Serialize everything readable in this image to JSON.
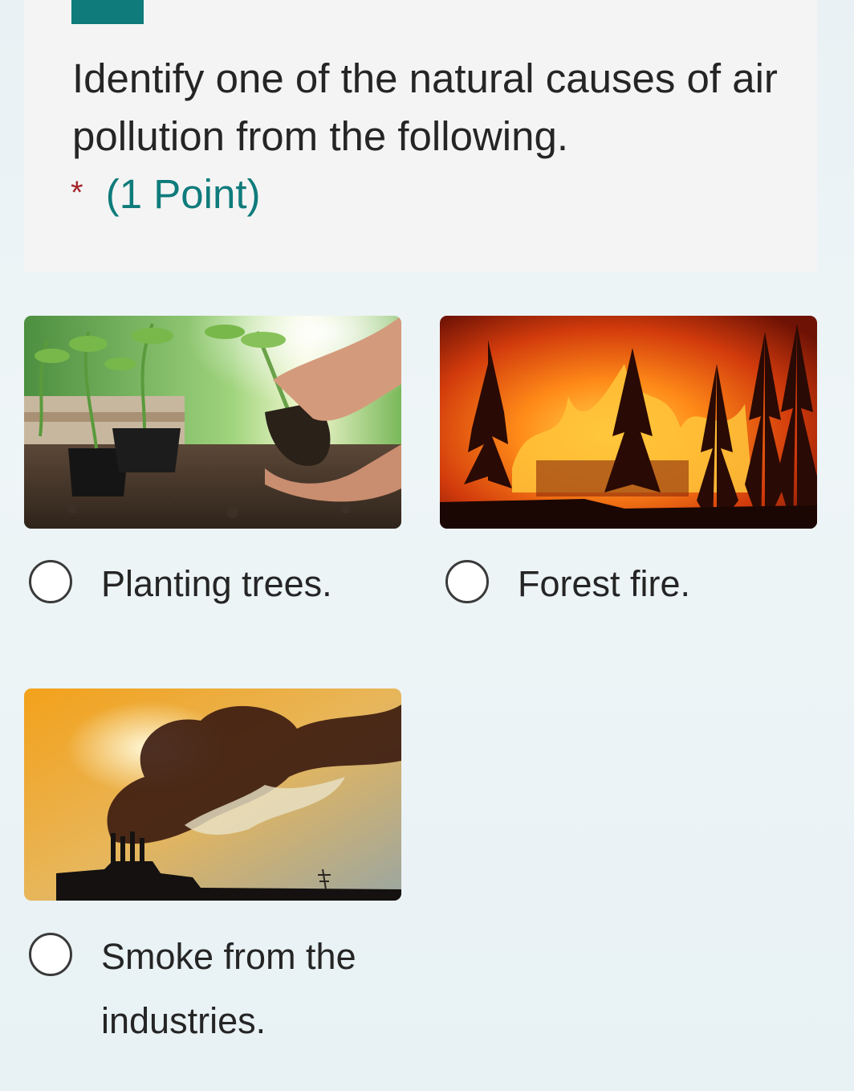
{
  "question": {
    "title": "Identify one of the natural causes of air pollution from the following.",
    "required_marker": "*",
    "points": "(1 Point)"
  },
  "options": [
    {
      "label": "Planting trees.",
      "image": "planting-trees-photo",
      "selected": false
    },
    {
      "label": "Forest fire.",
      "image": "forest-fire-photo",
      "selected": false
    },
    {
      "label": "Smoke from the industries.",
      "image": "industrial-smoke-photo",
      "selected": false
    }
  ],
  "colors": {
    "accent": "#0f7b7b",
    "required": "#a4262c",
    "card_background": "#f4f4f4",
    "page_background": "#eaf2f5"
  },
  "icons": {
    "radio": "radio-unchecked-icon"
  }
}
